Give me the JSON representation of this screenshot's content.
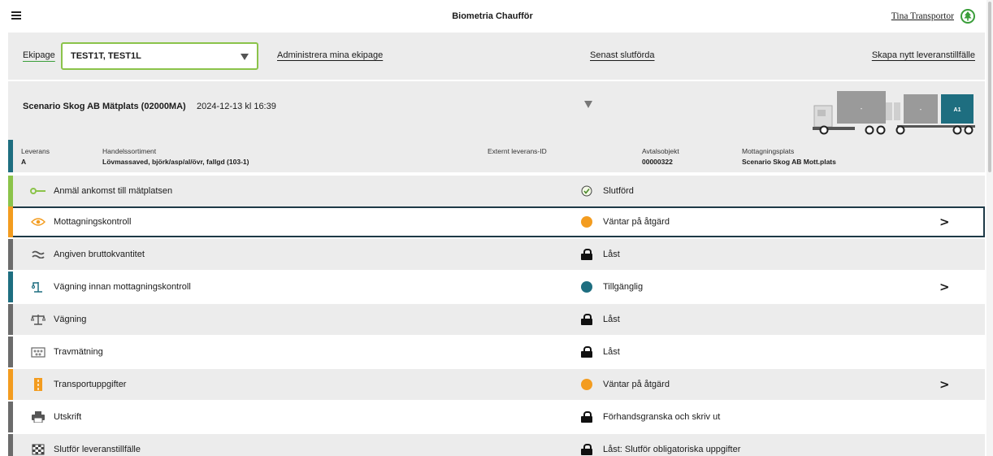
{
  "header": {
    "title": "Biometria Chaufför",
    "user": "Tina Transportor"
  },
  "toolbar": {
    "ekipage_label": "Ekipage",
    "ekipage_value": "TEST1T, TEST1L",
    "admin_link": "Administrera mina ekipage",
    "recent_link": "Senast slutförda",
    "create_link": "Skapa nytt leveranstillfälle"
  },
  "scenario": {
    "title": "Scenario Skog AB Mätplats (02000MA)",
    "date": "2024-12-13 kl 16:39",
    "truck": {
      "slot1": "-",
      "slot2": "-",
      "slot3": "A1"
    }
  },
  "delivery": {
    "leverans_label": "Leverans",
    "leverans_value": "A",
    "sortiment_label": "Handelssortiment",
    "sortiment_value": "Lövmassaved, björk/asp/al/övr, fallgd (103-1)",
    "extern_label": "Externt leverans-ID",
    "avtal_label": "Avtalsobjekt",
    "avtal_value": "00000322",
    "mottagning_label": "Mottagningsplats",
    "mottagning_value": "Scenario Skog AB Mott.plats"
  },
  "colors": {
    "green": "#8bc34a",
    "orange": "#f39c1f",
    "teal": "#1e6e80",
    "grey": "#6b6b6b"
  },
  "steps": [
    {
      "label": "Anmäl ankomst till mätplatsen",
      "icon": "key-icon",
      "status": "Slutförd",
      "status_icon": "check-circle-icon",
      "chevron": ""
    },
    {
      "label": "Mottagningskontroll",
      "icon": "eye-icon",
      "status": "Väntar på åtgärd",
      "status_icon": "orange-dot-icon",
      "chevron": ">"
    },
    {
      "label": "Angiven bruttokvantitet",
      "icon": "approx-icon",
      "status": "Låst",
      "status_icon": "lock-icon",
      "chevron": ""
    },
    {
      "label": "Vägning innan mottagningskontroll",
      "icon": "crane-scale-icon",
      "status": "Tillgänglig",
      "status_icon": "teal-dot-icon",
      "chevron": ">"
    },
    {
      "label": "Vägning",
      "icon": "scale-icon",
      "status": "Låst",
      "status_icon": "lock-icon",
      "chevron": ""
    },
    {
      "label": "Travmätning",
      "icon": "stack-measure-icon",
      "status": "Låst",
      "status_icon": "lock-icon",
      "chevron": ""
    },
    {
      "label": "Transportuppgifter",
      "icon": "road-icon",
      "status": "Väntar på åtgärd",
      "status_icon": "orange-dot-icon",
      "chevron": ">"
    },
    {
      "label": "Utskrift",
      "icon": "printer-icon",
      "status": "Förhandsgranska och skriv ut",
      "status_icon": "lock-icon",
      "chevron": ""
    },
    {
      "label": "Slutför leveranstillfälle",
      "icon": "checkered-flag-icon",
      "status": "Låst: Slutför obligatoriska uppgifter",
      "status_icon": "lock-icon",
      "chevron": ""
    }
  ]
}
